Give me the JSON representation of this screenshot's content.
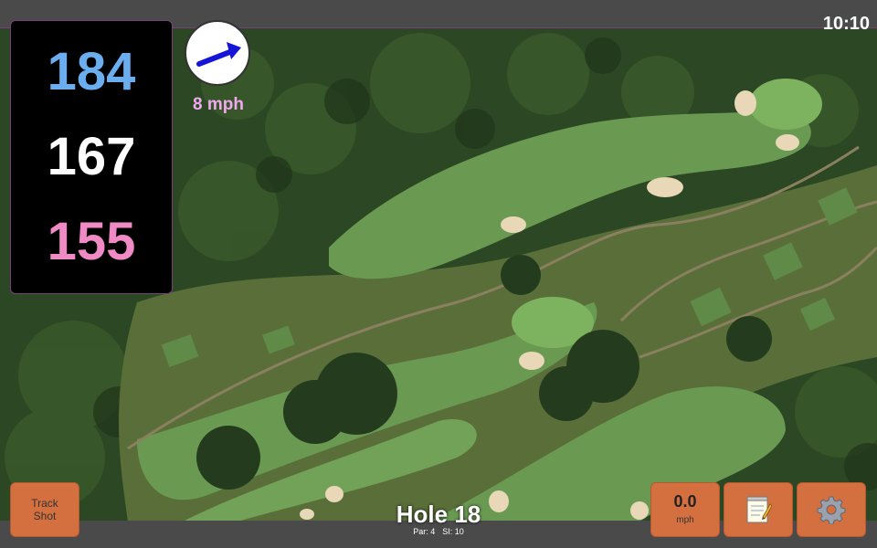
{
  "clock": "10:10",
  "distances": {
    "back": "184",
    "middle": "167",
    "front": "155"
  },
  "wind": {
    "speed": "8 mph",
    "icon": "wind-arrow-icon"
  },
  "hole": {
    "title": "Hole 18",
    "par": "Par: 4",
    "si": "SI: 10"
  },
  "buttons": {
    "track_line1": "Track",
    "track_line2": "Shot",
    "speed_value": "0.0",
    "speed_unit": "mph",
    "notes_icon": "notepad-icon",
    "settings_icon": "gear-icon"
  },
  "colors": {
    "back": "#6aaef0",
    "middle": "#ffffff",
    "front": "#f08ac4",
    "button": "#d47040",
    "wind_text": "#f0a8ee"
  }
}
